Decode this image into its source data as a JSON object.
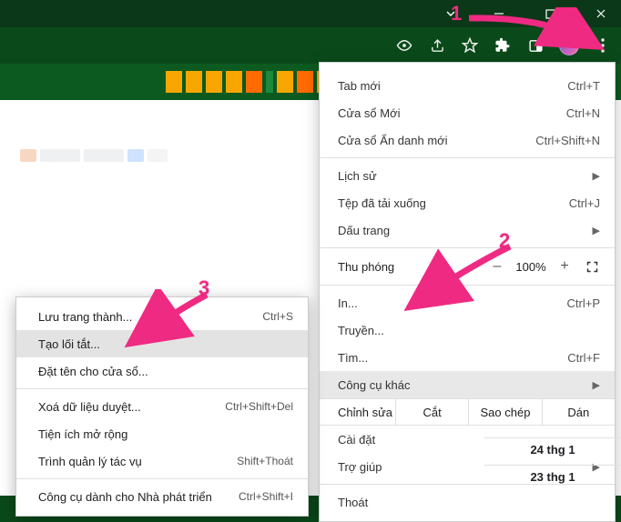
{
  "window_controls": {
    "chevron": "v",
    "min": "—",
    "max": "☐",
    "close": "✕"
  },
  "toolbar_icons": [
    "eye-icon",
    "share-icon",
    "star-icon",
    "extensions-icon",
    "sidepanel-icon",
    "avatar",
    "kebab-icon"
  ],
  "blocks": [
    {
      "color": "#f7a600"
    },
    {
      "color": "#f7a600"
    },
    {
      "color": "#f7a600"
    },
    {
      "color": "#f7a600"
    },
    {
      "color": "#ff6b00"
    },
    {
      "color": "#1b8a3a"
    },
    {
      "color": "#f7a600"
    },
    {
      "color": "#ff6b00"
    },
    {
      "color": "#f7a600"
    }
  ],
  "menu": {
    "new_tab": {
      "label": "Tab mới",
      "shortcut": "Ctrl+T"
    },
    "new_window": {
      "label": "Cửa sổ Mới",
      "shortcut": "Ctrl+N"
    },
    "incognito": {
      "label": "Cửa sổ Ẩn danh mới",
      "shortcut": "Ctrl+Shift+N"
    },
    "history": {
      "label": "Lịch sử"
    },
    "downloads": {
      "label": "Tệp đã tải xuống",
      "shortcut": "Ctrl+J"
    },
    "bookmarks": {
      "label": "Dấu trang"
    },
    "zoom": {
      "label": "Thu phóng",
      "value": "100%",
      "minus": "–",
      "plus": "+"
    },
    "print": {
      "label": "In...",
      "shortcut": "Ctrl+P"
    },
    "cast": {
      "label": "Truyền..."
    },
    "find": {
      "label": "Tìm...",
      "shortcut": "Ctrl+F"
    },
    "more_tools": {
      "label": "Công cụ khác"
    },
    "edit": {
      "label": "Chỉnh sửa",
      "cut": "Cắt",
      "copy": "Sao chép",
      "paste": "Dán"
    },
    "settings": {
      "label": "Cài đặt"
    },
    "help": {
      "label": "Trợ giúp"
    },
    "exit": {
      "label": "Thoát"
    }
  },
  "submenu": {
    "save_page": {
      "label": "Lưu trang thành...",
      "shortcut": "Ctrl+S"
    },
    "create_shortcut": {
      "label": "Tạo lối tắt..."
    },
    "name_window": {
      "label": "Đặt tên cho cửa sổ..."
    },
    "clear_data": {
      "label": "Xoá dữ liệu duyệt...",
      "shortcut": "Ctrl+Shift+Del"
    },
    "extensions": {
      "label": "Tiện ích mở rộng"
    },
    "task_manager": {
      "label": "Trình quản lý tác vụ",
      "shortcut": "Shift+Thoát"
    },
    "dev_tools": {
      "label": "Công cụ dành cho Nhà phát triển",
      "shortcut": "Ctrl+Shift+I"
    }
  },
  "dates": {
    "row1": "24 thg 1",
    "row2": "23 thg 1"
  },
  "annotations": {
    "one": "1",
    "two": "2",
    "three": "3"
  }
}
